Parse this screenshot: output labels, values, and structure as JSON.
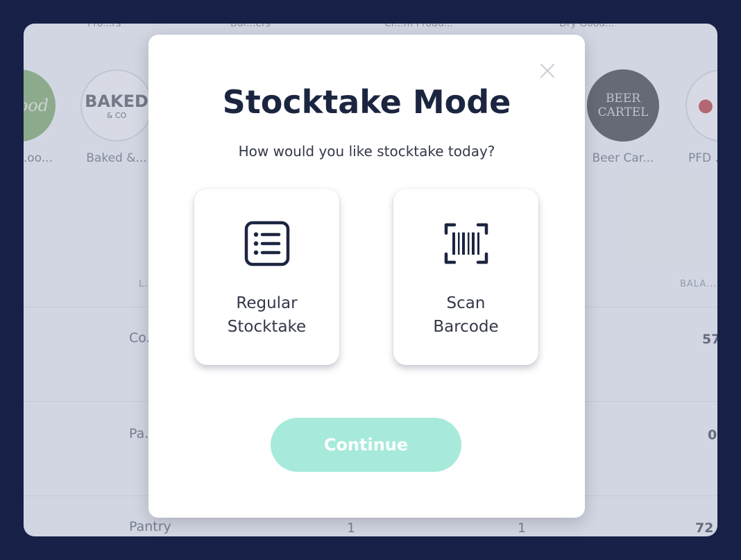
{
  "background": {
    "top_row": [
      "Pro...rs",
      "Bur...ers",
      "Cr...m Produ...",
      "Dry Good..."
    ],
    "suppliers": [
      {
        "name": "...oo...",
        "logo_text": "ood"
      },
      {
        "name": "Baked &...",
        "logo_text": "BAKED",
        "logo_sub": "& CO"
      },
      {
        "name": "Beer Car...",
        "logo_text": "BEER CARTEL"
      },
      {
        "name": "PFD ...",
        "logo_text": "●"
      }
    ],
    "table": {
      "headers": [
        "L...",
        "BALA..."
      ],
      "rows": [
        {
          "location": "Co...",
          "balance": "57"
        },
        {
          "location": "Pa...",
          "balance": "0"
        },
        {
          "location": "Pantry",
          "col2": "1",
          "col3": "1",
          "balance": "72"
        }
      ]
    }
  },
  "modal": {
    "title": "Stocktake Mode",
    "subtitle": "How would you like stocktake today?",
    "options": [
      {
        "line1": "Regular",
        "line2": "Stocktake",
        "icon": "list-icon"
      },
      {
        "line1": "Scan",
        "line2": "Barcode",
        "icon": "barcode-scan-icon"
      }
    ],
    "continue_label": "Continue",
    "accent_color": "#a7eadb",
    "close_icon": "close-icon"
  }
}
